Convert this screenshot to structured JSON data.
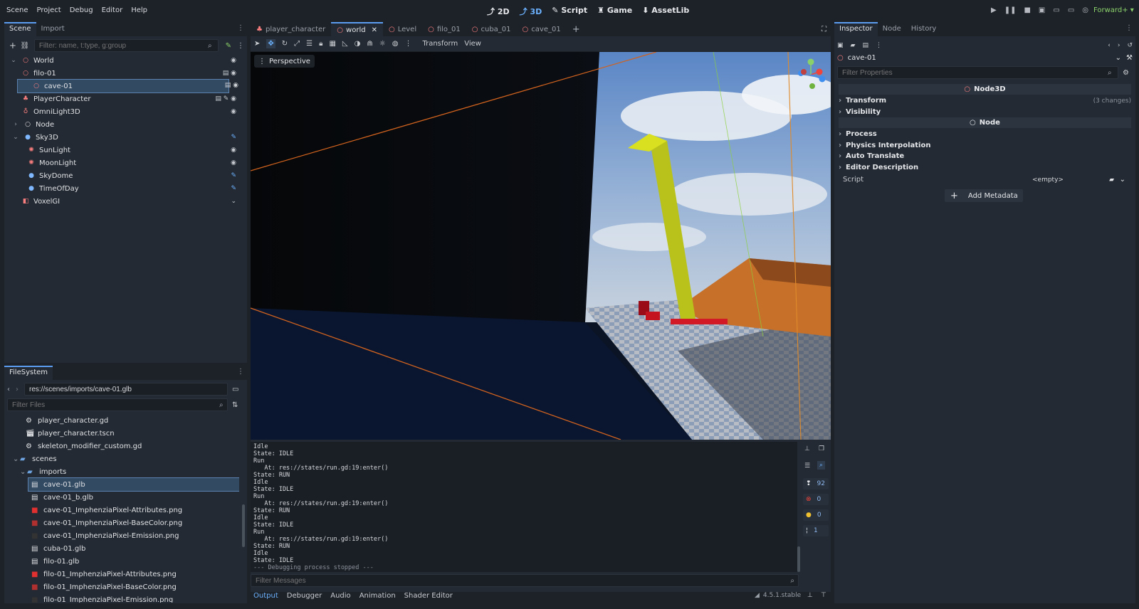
{
  "menu": [
    "Scene",
    "Project",
    "Debug",
    "Editor",
    "Help"
  ],
  "workspaces": [
    {
      "label": "2D",
      "active": false
    },
    {
      "label": "3D",
      "active": true
    },
    {
      "label": "Script",
      "active": false
    },
    {
      "label": "Game",
      "active": false
    },
    {
      "label": "AssetLib",
      "active": false
    }
  ],
  "renderer": "Forward+",
  "scene_dock": {
    "tabs": [
      "Scene",
      "Import"
    ],
    "filter_placeholder": "Filter: name, t:type, g:group",
    "nodes": [
      {
        "label": "World",
        "icon": "node3d-icon"
      },
      {
        "label": "filo-01",
        "icon": "node3d-icon"
      },
      {
        "label": "cave-01",
        "icon": "node3d-icon",
        "selected": true
      },
      {
        "label": "PlayerCharacter",
        "icon": "character-icon"
      },
      {
        "label": "OmniLight3D",
        "icon": "omnilight-icon"
      },
      {
        "label": "Node",
        "icon": "node-icon"
      },
      {
        "label": "Sky3D",
        "icon": "sky-icon"
      },
      {
        "label": "SunLight",
        "icon": "light-icon"
      },
      {
        "label": "MoonLight",
        "icon": "light-icon"
      },
      {
        "label": "SkyDome",
        "icon": "sky-icon"
      },
      {
        "label": "TimeOfDay",
        "icon": "sky-icon"
      },
      {
        "label": "VoxelGI",
        "icon": "voxelgi-icon"
      }
    ]
  },
  "filesystem": {
    "title": "FileSystem",
    "path": "res://scenes/imports/cave-01.glb",
    "filter_placeholder": "Filter Files",
    "items": [
      {
        "label": "player_character.gd",
        "icon": "gear-icon"
      },
      {
        "label": "player_character.tscn",
        "icon": "scene-icon"
      },
      {
        "label": "skeleton_modifier_custom.gd",
        "icon": "gear-icon"
      },
      {
        "label": "scenes",
        "icon": "folder-icon"
      },
      {
        "label": "imports",
        "icon": "folder-icon"
      },
      {
        "label": "cave-01.glb",
        "icon": "scene-icon",
        "selected": true
      },
      {
        "label": "cave-01_b.glb",
        "icon": "scene-icon"
      },
      {
        "label": "cave-01_ImphenziaPixel-Attributes.png",
        "icon": "image-icon"
      },
      {
        "label": "cave-01_ImphenziaPixel-BaseColor.png",
        "icon": "image-icon"
      },
      {
        "label": "cave-01_ImphenziaPixel-Emission.png",
        "icon": "image-icon"
      },
      {
        "label": "cuba-01.glb",
        "icon": "scene-icon"
      },
      {
        "label": "filo-01.glb",
        "icon": "scene-icon"
      },
      {
        "label": "filo-01_ImphenziaPixel-Attributes.png",
        "icon": "image-icon"
      },
      {
        "label": "filo-01_ImphenziaPixel-BaseColor.png",
        "icon": "image-icon"
      },
      {
        "label": "filo-01_ImphenziaPixel-Emission.png",
        "icon": "image-icon"
      }
    ]
  },
  "editor_tabs": [
    {
      "label": "player_character",
      "active": false
    },
    {
      "label": "world",
      "active": true
    },
    {
      "label": "Level",
      "active": false
    },
    {
      "label": "filo_01",
      "active": false
    },
    {
      "label": "cuba_01",
      "active": false
    },
    {
      "label": "cave_01",
      "active": false
    }
  ],
  "viewport_toolbar": {
    "transform": "Transform",
    "view": "View"
  },
  "viewport_label": "Perspective",
  "console": {
    "lines": [
      "Idle",
      "State: IDLE",
      "Run",
      "   At: res://states/run.gd:19:enter()",
      "State: RUN",
      "Idle",
      "State: IDLE",
      "Run",
      "   At: res://states/run.gd:19:enter()",
      "State: RUN",
      "Idle",
      "State: IDLE",
      "Run",
      "   At: res://states/run.gd:19:enter()",
      "State: RUN",
      "Idle",
      "State: IDLE",
      "--- Debugging process stopped ---"
    ],
    "filter_placeholder": "Filter Messages",
    "counts": {
      "messages": "92",
      "errors": "0",
      "warnings": "0",
      "info": "1"
    }
  },
  "bottom_tabs": [
    "Output",
    "Debugger",
    "Audio",
    "Animation",
    "Shader Editor"
  ],
  "version": "4.5.1.stable",
  "inspector": {
    "tabs": [
      "Inspector",
      "Node",
      "History"
    ],
    "object": "cave-01",
    "filter_placeholder": "Filter Properties",
    "section_node3d": "Node3D",
    "transform": "Transform",
    "transform_changes": "(3 changes)",
    "visibility": "Visibility",
    "section_node": "Node",
    "groups": [
      "Process",
      "Physics Interpolation",
      "Auto Translate",
      "Editor Description"
    ],
    "script_label": "Script",
    "script_value": "<empty>",
    "add_metadata": "Add Metadata"
  },
  "colors": {
    "accent": "#6cb2ff",
    "node3d": "#fc7f7f",
    "selection": "#334a63"
  }
}
